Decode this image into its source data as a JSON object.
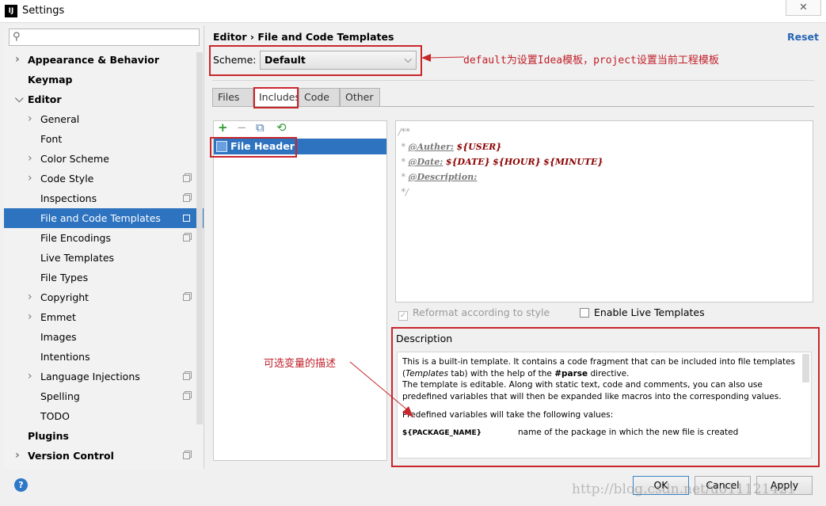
{
  "window": {
    "title": "Settings",
    "app_icon": "IJ",
    "close": "✕"
  },
  "sidebar": {
    "search_placeholder": "",
    "items": [
      {
        "label": "Appearance & Behavior",
        "level": 0,
        "bold": true,
        "arrow": "right"
      },
      {
        "label": "Keymap",
        "level": 0,
        "bold": true
      },
      {
        "label": "Editor",
        "level": 0,
        "bold": true,
        "arrow": "down"
      },
      {
        "label": "General",
        "level": 1,
        "arrow": "right"
      },
      {
        "label": "Font",
        "level": 1
      },
      {
        "label": "Color Scheme",
        "level": 1,
        "arrow": "right"
      },
      {
        "label": "Code Style",
        "level": 1,
        "arrow": "right",
        "copy": true
      },
      {
        "label": "Inspections",
        "level": 1,
        "copy": true
      },
      {
        "label": "File and Code Templates",
        "level": 1,
        "copy": true,
        "selected": true
      },
      {
        "label": "File Encodings",
        "level": 1,
        "copy": true
      },
      {
        "label": "Live Templates",
        "level": 1
      },
      {
        "label": "File Types",
        "level": 1
      },
      {
        "label": "Copyright",
        "level": 1,
        "arrow": "right",
        "copy": true
      },
      {
        "label": "Emmet",
        "level": 1,
        "arrow": "right"
      },
      {
        "label": "Images",
        "level": 1
      },
      {
        "label": "Intentions",
        "level": 1
      },
      {
        "label": "Language Injections",
        "level": 1,
        "arrow": "right",
        "copy": true
      },
      {
        "label": "Spelling",
        "level": 1,
        "copy": true
      },
      {
        "label": "TODO",
        "level": 1
      },
      {
        "label": "Plugins",
        "level": 0,
        "bold": true
      },
      {
        "label": "Version Control",
        "level": 0,
        "bold": true,
        "arrow": "right",
        "copy": true
      }
    ]
  },
  "header": {
    "breadcrumb": "Editor › File and Code Templates",
    "reset": "Reset"
  },
  "scheme": {
    "label": "Scheme:",
    "value": "Default"
  },
  "annotations": {
    "scheme_note": "default为设置Idea模板，project设置当前工程模板",
    "desc_note": "可选变量的描述"
  },
  "tabs": [
    {
      "label": "Files"
    },
    {
      "label": "Includes",
      "active": true
    },
    {
      "label": "Code"
    },
    {
      "label": "Other"
    }
  ],
  "template_list": {
    "items": [
      "File Header"
    ],
    "selected": "File Header"
  },
  "editor": {
    "line1": "/**",
    "star": "*",
    "auther_tag": "@Auther:",
    "user_var": "${USER}",
    "date_tag": "@Date:",
    "date_var": "${DATE}",
    "hour_var": "${HOUR}",
    "minute_var": "${MINUTE}",
    "desc_tag": "@Description:",
    "end": "*/"
  },
  "options": {
    "reformat": "Reformat according to style",
    "reformat_checked": true,
    "reformat_enabled": false,
    "live": "Enable Live Templates",
    "live_checked": false
  },
  "description": {
    "title": "Description",
    "p1a": "This is a built-in template. It contains a code fragment that can be included into file templates (",
    "p1b": "Templates",
    "p1c": " tab) with the help of the ",
    "p1d": "#parse",
    "p1e": " directive.",
    "p2": "The template is editable. Along with static text, code and comments, you can also use predefined variables that will then be expanded like macros into the corresponding values.",
    "p3": "Predefined variables will take the following values:",
    "var_name": "${PACKAGE_NAME}",
    "var_desc": "name of the package in which the new file is created"
  },
  "buttons": {
    "ok": "OK",
    "cancel": "Cancel",
    "apply": "Apply",
    "help": "?"
  },
  "watermark": "http://blog.csdn.net/u011121421",
  "colors": {
    "accent": "#2d73c0",
    "annotation": "#c8262b",
    "link": "#2766b5"
  }
}
